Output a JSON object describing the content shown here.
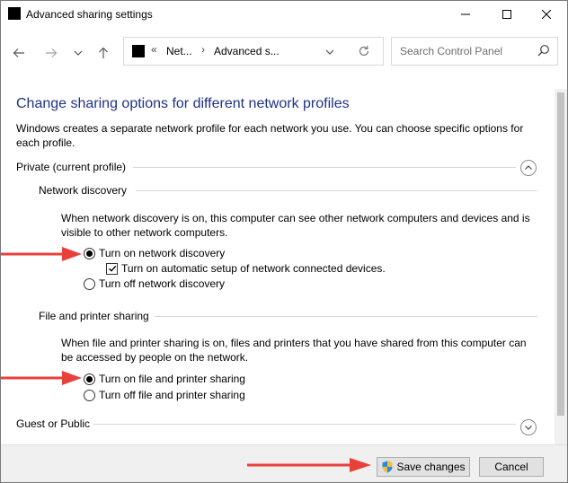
{
  "window": {
    "title": "Advanced sharing settings",
    "minimize_glyph": "—",
    "maximize_glyph": "☐",
    "close_glyph": "✕"
  },
  "nav": {
    "back_icon": "arrow-left-icon",
    "forward_icon": "arrow-right-icon",
    "recent_icon": "chevron-down-icon",
    "up_icon": "arrow-up-icon",
    "address_overflow": "«",
    "address_crumb1": "Net...",
    "address_sep": "›",
    "address_crumb2": "Advanced s...",
    "search_placeholder": "Search Control Panel"
  },
  "content": {
    "heading": "Change sharing options for different network profiles",
    "intro": "Windows creates a separate network profile for each network you use. You can choose specific options for each profile.",
    "private_profile": {
      "title": "Private (current profile)",
      "expanded": true
    },
    "network_discovery": {
      "title": "Network discovery",
      "description": "When network discovery is on, this computer can see other network computers and devices and is visible to other network computers.",
      "option_on": "Turn on network discovery",
      "option_auto": "Turn on automatic setup of network connected devices.",
      "option_off": "Turn off network discovery",
      "selected": "on",
      "auto_checked": true
    },
    "file_printer_sharing": {
      "title": "File and printer sharing",
      "description": "When file and printer sharing is on, files and printers that you have shared from this computer can be accessed by people on the network.",
      "option_on": "Turn on file and printer sharing",
      "option_off": "Turn off file and printer sharing",
      "selected": "on"
    },
    "guest_profile": {
      "title": "Guest or Public",
      "expanded": false
    }
  },
  "footer": {
    "save_label": "Save changes",
    "cancel_label": "Cancel",
    "save_icon": "uac-shield-icon"
  },
  "colors": {
    "heading": "#1e3287",
    "annotation_arrow": "#e8413c"
  }
}
